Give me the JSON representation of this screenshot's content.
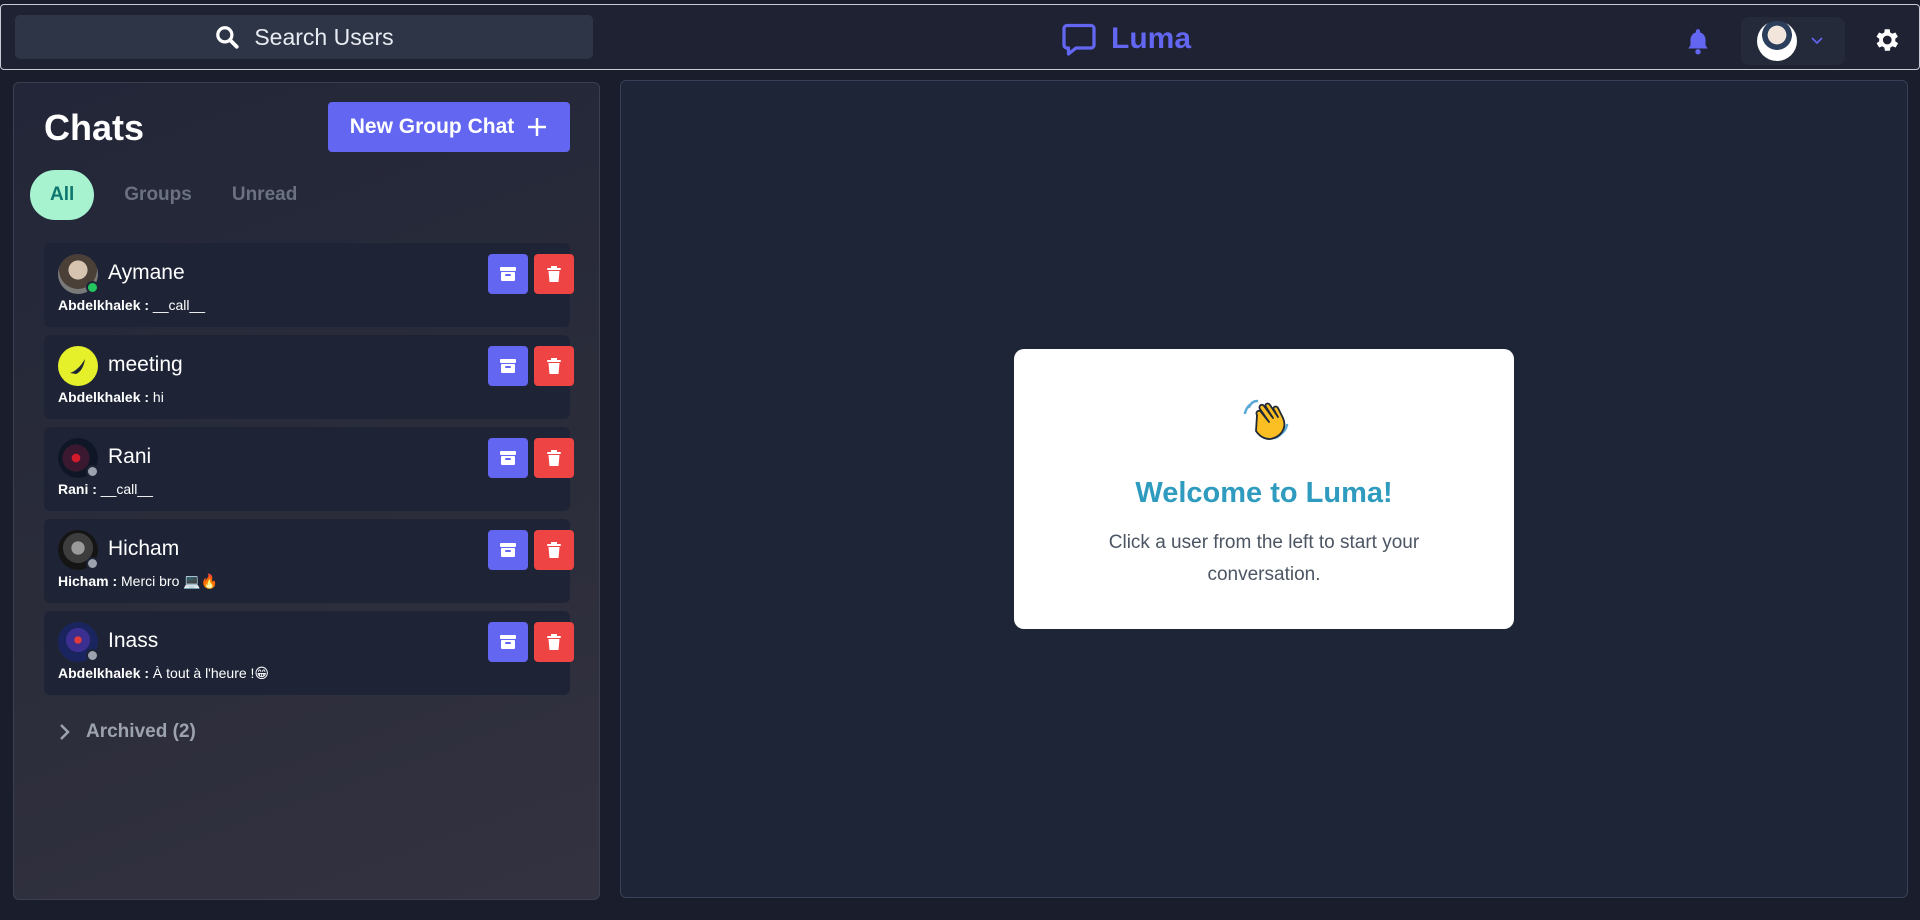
{
  "header": {
    "search_label": "Search Users",
    "brand_name": "Luma"
  },
  "sidebar": {
    "title": "Chats",
    "new_group_label": "New Group Chat",
    "tabs": [
      {
        "label": "All",
        "active": true
      },
      {
        "label": "Groups",
        "active": false
      },
      {
        "label": "Unread",
        "active": false
      }
    ],
    "chats": [
      {
        "name": "Aymane",
        "sender": "Abdelkhalek :",
        "message": "__call__",
        "status": "online",
        "avatar_color": "#6b6b6b"
      },
      {
        "name": "meeting",
        "sender": "Abdelkhalek :",
        "message": "hi",
        "status": "none",
        "avatar_color": "#e5f02a"
      },
      {
        "name": "Rani",
        "sender": "Rani :",
        "message": "__call__",
        "status": "offline",
        "avatar_color": "#2a1a2e"
      },
      {
        "name": "Hicham",
        "sender": "Hicham :",
        "message": "Merci bro 💻🔥",
        "status": "offline",
        "avatar_color": "#2b2b2b"
      },
      {
        "name": "Inass",
        "sender": "Abdelkhalek :",
        "message": "À tout à l'heure !😁",
        "status": "offline",
        "avatar_color": "#1f3a8a"
      }
    ],
    "archived_label": "Archived (2)"
  },
  "welcome": {
    "title": "Welcome to Luma!",
    "text": "Click a user from the left to start your conversation."
  },
  "colors": {
    "accent": "#6366f1",
    "danger": "#ef4444",
    "online": "#22c55e",
    "offline": "#9ca3af",
    "welcome_title": "#2e9bbf"
  }
}
